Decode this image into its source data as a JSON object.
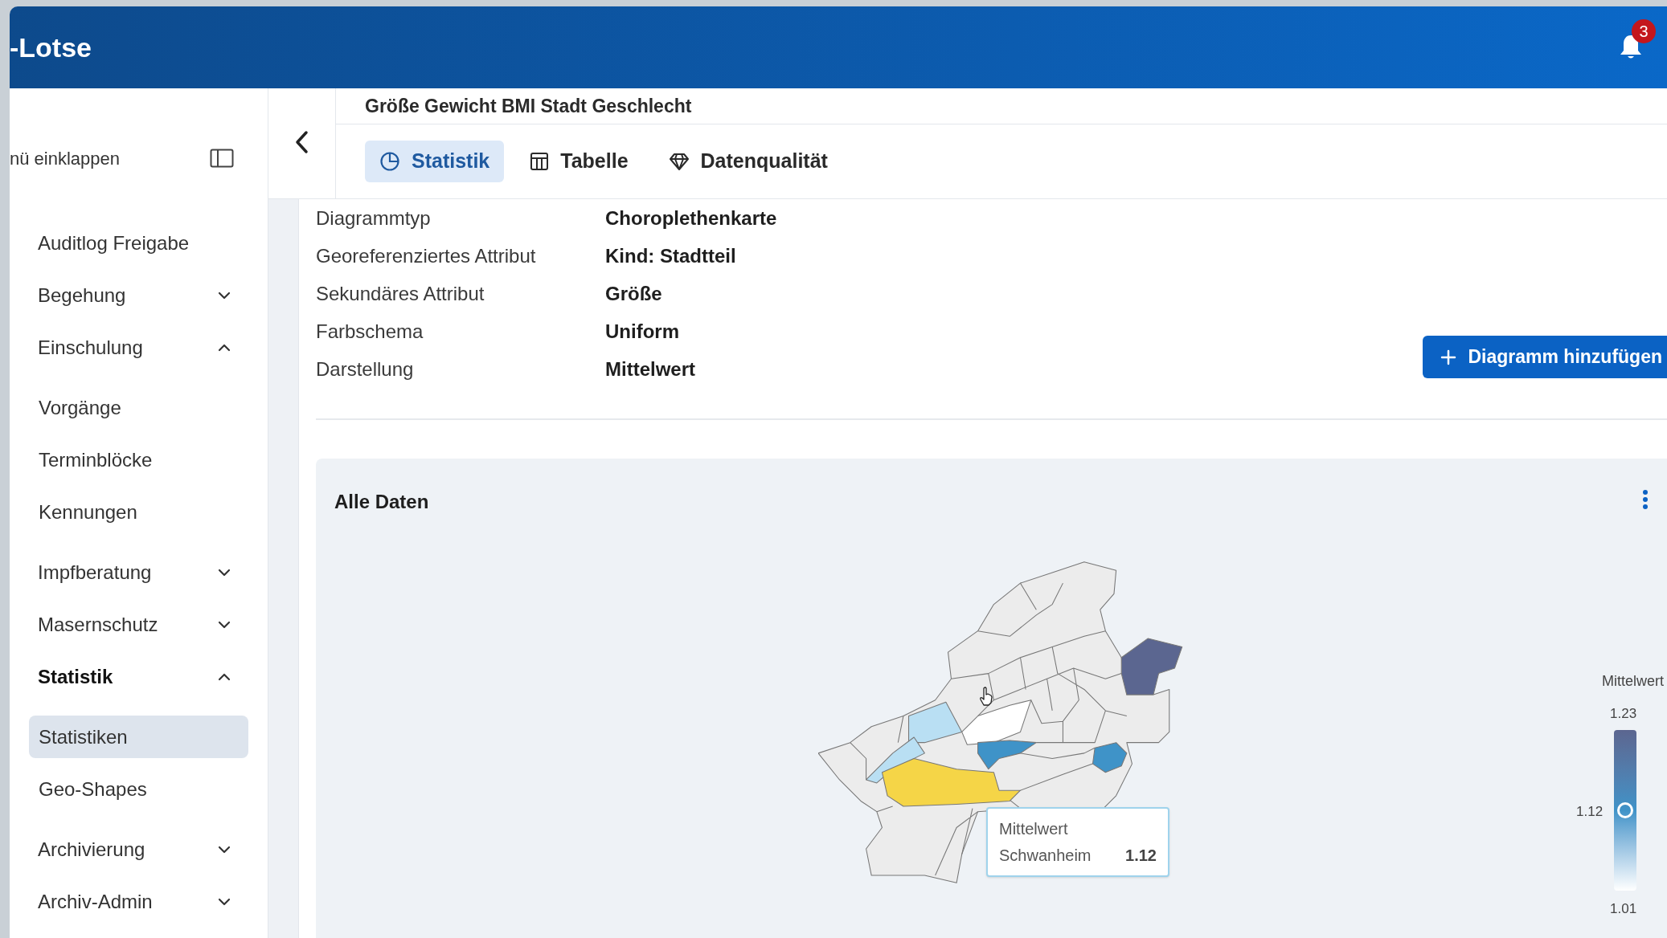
{
  "header": {
    "title": "-Lotse",
    "notifications": {
      "count": "3"
    }
  },
  "sidebar": {
    "collapse_label": "nü einklappen",
    "items": [
      {
        "label": "Auditlog Freigabe",
        "selected": false
      },
      {
        "label": "Begehung",
        "selected": false,
        "expanded": false
      },
      {
        "label": "Einschulung",
        "selected": false,
        "expanded": true,
        "children": [
          {
            "label": "Vorgänge",
            "selected": false
          },
          {
            "label": "Terminblöcke",
            "selected": false
          },
          {
            "label": "Kennungen",
            "selected": false
          }
        ]
      },
      {
        "label": "Impfberatung",
        "selected": false,
        "expanded": false
      },
      {
        "label": "Masernschutz",
        "selected": false,
        "expanded": false
      },
      {
        "label": "Statistik",
        "selected": true,
        "expanded": true,
        "children": [
          {
            "label": "Statistiken",
            "selected": true
          },
          {
            "label": "Geo-Shapes",
            "selected": false
          }
        ]
      },
      {
        "label": "Archivierung",
        "selected": false,
        "expanded": false
      },
      {
        "label": "Archiv-Admin",
        "selected": false,
        "expanded": false
      }
    ]
  },
  "page": {
    "title": "Größe Gewicht BMI Stadt Geschlecht",
    "tabs": [
      {
        "label": "Statistik",
        "kind": "statistics",
        "selected": true
      },
      {
        "label": "Tabelle",
        "kind": "table",
        "selected": false
      },
      {
        "label": "Datenqualität",
        "kind": "quality",
        "selected": false
      }
    ],
    "properties": [
      {
        "label": "Diagrammtyp",
        "value": "Choroplethenkarte"
      },
      {
        "label": "Georeferenziertes Attribut",
        "value": "Kind: Stadtteil"
      },
      {
        "label": "Sekundäres Attribut",
        "value": "Größe"
      },
      {
        "label": "Farbschema",
        "value": "Uniform"
      },
      {
        "label": "Darstellung",
        "value": "Mittelwert"
      }
    ],
    "add_button": "Diagramm hinzufügen",
    "card": {
      "title": "Alle Daten",
      "tooltip": {
        "title": "Mittelwert",
        "name": "Schwanheim",
        "value": "1.12"
      },
      "legend": {
        "title": "Mittelwert",
        "max": "1.23",
        "current": "1.12",
        "min": "1.01",
        "level": 0.5
      }
    }
  }
}
